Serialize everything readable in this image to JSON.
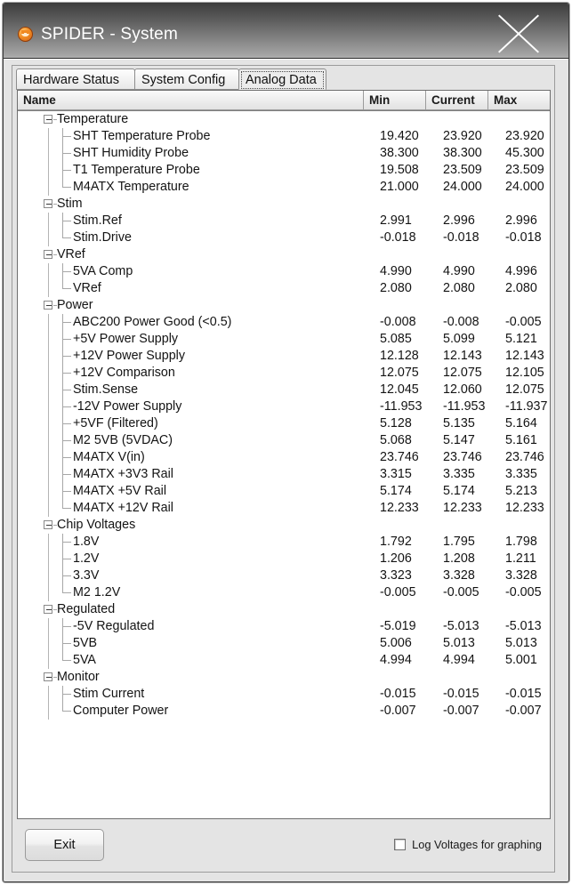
{
  "window": {
    "title": "SPIDER - System",
    "app_icon": "spider-icon",
    "close_icon": "close-icon"
  },
  "tabs": [
    {
      "label": "Hardware Status",
      "selected": false
    },
    {
      "label": "System Config",
      "selected": false
    },
    {
      "label": "Analog Data",
      "selected": true
    }
  ],
  "grid": {
    "columns": [
      "Name",
      "Min",
      "Current",
      "Max"
    ],
    "rows": [
      {
        "type": "group",
        "name": "Temperature",
        "min": "",
        "current": "",
        "max": ""
      },
      {
        "type": "leaf",
        "name": "SHT Temperature Probe",
        "min": "19.420",
        "current": "23.920",
        "max": "23.920"
      },
      {
        "type": "leaf",
        "name": "SHT Humidity Probe",
        "min": "38.300",
        "current": "38.300",
        "max": "45.300"
      },
      {
        "type": "leaf",
        "name": "T1 Temperature Probe",
        "min": "19.508",
        "current": "23.509",
        "max": "23.509"
      },
      {
        "type": "last",
        "name": "M4ATX Temperature",
        "min": "21.000",
        "current": "24.000",
        "max": "24.000"
      },
      {
        "type": "group",
        "name": "Stim",
        "min": "",
        "current": "",
        "max": ""
      },
      {
        "type": "leaf",
        "name": "Stim.Ref",
        "min": "2.991",
        "current": "2.996",
        "max": "2.996"
      },
      {
        "type": "last",
        "name": "Stim.Drive",
        "min": "-0.018",
        "current": "-0.018",
        "max": "-0.018"
      },
      {
        "type": "group",
        "name": "VRef",
        "min": "",
        "current": "",
        "max": ""
      },
      {
        "type": "leaf",
        "name": "5VA Comp",
        "min": "4.990",
        "current": "4.990",
        "max": "4.996"
      },
      {
        "type": "last",
        "name": "VRef",
        "min": "2.080",
        "current": "2.080",
        "max": "2.080"
      },
      {
        "type": "group",
        "name": "Power",
        "min": "",
        "current": "",
        "max": ""
      },
      {
        "type": "leaf",
        "name": "ABC200 Power Good (<0.5)",
        "min": "-0.008",
        "current": "-0.008",
        "max": "-0.005"
      },
      {
        "type": "leaf",
        "name": "+5V Power Supply",
        "min": "5.085",
        "current": "5.099",
        "max": "5.121"
      },
      {
        "type": "leaf",
        "name": "+12V Power Supply",
        "min": "12.128",
        "current": "12.143",
        "max": "12.143"
      },
      {
        "type": "leaf",
        "name": "+12V Comparison",
        "min": "12.075",
        "current": "12.075",
        "max": "12.105"
      },
      {
        "type": "leaf",
        "name": "Stim.Sense",
        "min": "12.045",
        "current": "12.060",
        "max": "12.075"
      },
      {
        "type": "leaf",
        "name": "-12V Power Supply",
        "min": "-11.953",
        "current": "-11.953",
        "max": "-11.937"
      },
      {
        "type": "leaf",
        "name": "+5VF (Filtered)",
        "min": "5.128",
        "current": "5.135",
        "max": "5.164"
      },
      {
        "type": "leaf",
        "name": "M2 5VB (5VDAC)",
        "min": "5.068",
        "current": "5.147",
        "max": "5.161"
      },
      {
        "type": "leaf",
        "name": "M4ATX V(in)",
        "min": "23.746",
        "current": "23.746",
        "max": "23.746"
      },
      {
        "type": "leaf",
        "name": "M4ATX +3V3 Rail",
        "min": "3.315",
        "current": "3.335",
        "max": "3.335"
      },
      {
        "type": "leaf",
        "name": "M4ATX +5V Rail",
        "min": "5.174",
        "current": "5.174",
        "max": "5.213"
      },
      {
        "type": "last",
        "name": "M4ATX +12V Rail",
        "min": "12.233",
        "current": "12.233",
        "max": "12.233"
      },
      {
        "type": "group",
        "name": "Chip Voltages",
        "min": "",
        "current": "",
        "max": ""
      },
      {
        "type": "leaf",
        "name": "1.8V",
        "min": "1.792",
        "current": "1.795",
        "max": "1.798"
      },
      {
        "type": "leaf",
        "name": "1.2V",
        "min": "1.206",
        "current": "1.208",
        "max": "1.211"
      },
      {
        "type": "leaf",
        "name": "3.3V",
        "min": "3.323",
        "current": "3.328",
        "max": "3.328"
      },
      {
        "type": "last",
        "name": "M2 1.2V",
        "min": "-0.005",
        "current": "-0.005",
        "max": "-0.005"
      },
      {
        "type": "group",
        "name": "Regulated",
        "min": "",
        "current": "",
        "max": ""
      },
      {
        "type": "leaf",
        "name": "-5V Regulated",
        "min": "-5.019",
        "current": "-5.013",
        "max": "-5.013"
      },
      {
        "type": "leaf",
        "name": "5VB",
        "min": "5.006",
        "current": "5.013",
        "max": "5.013"
      },
      {
        "type": "last",
        "name": "5VA",
        "min": "4.994",
        "current": "4.994",
        "max": "5.001"
      },
      {
        "type": "group",
        "name": "Monitor",
        "min": "",
        "current": "",
        "max": ""
      },
      {
        "type": "leaf",
        "name": "Stim Current",
        "min": "-0.015",
        "current": "-0.015",
        "max": "-0.015"
      },
      {
        "type": "last",
        "name": "Computer Power",
        "min": "-0.007",
        "current": "-0.007",
        "max": "-0.007"
      }
    ]
  },
  "footer": {
    "exit_label": "Exit",
    "log_checkbox_label": "Log Voltages for graphing",
    "log_checkbox_checked": false
  }
}
